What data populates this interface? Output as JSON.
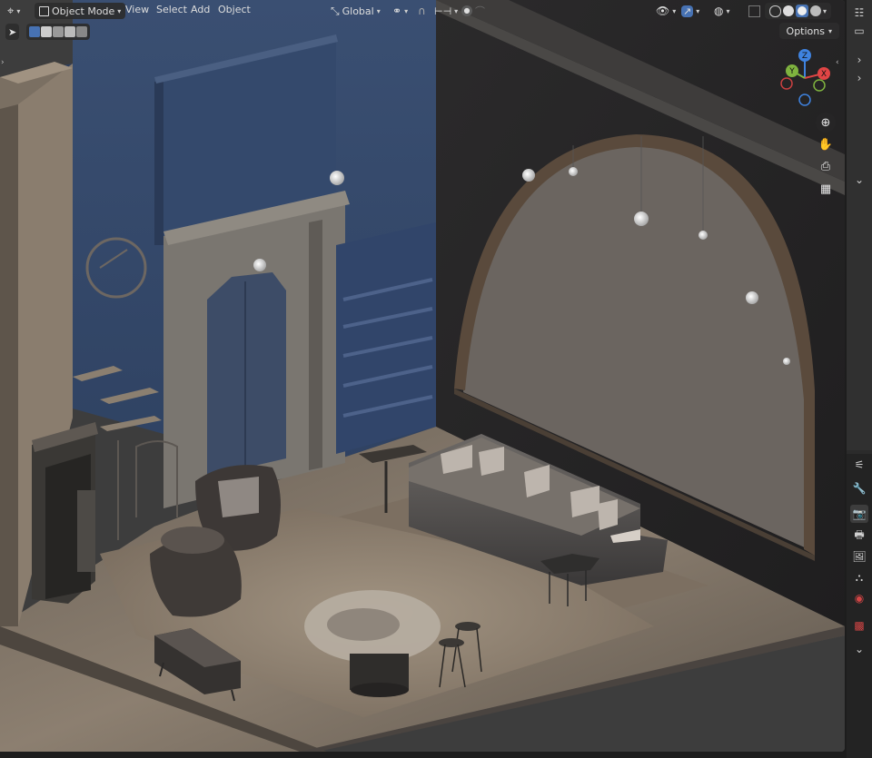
{
  "header": {
    "mode_label": "Object Mode",
    "menus": [
      "View",
      "Select",
      "Add",
      "Object"
    ],
    "transform_orientation": "Global",
    "options_label": "Options"
  },
  "gizmo": {
    "z_label": "Z",
    "y_label": "Y",
    "x_label": "X"
  },
  "icons": {
    "editor_type": "cursor-icon",
    "mode": "object-mode-icon",
    "orientation": "transform-orientation-icon",
    "pivot": "pivot-point-icon",
    "snap": "snap-icon",
    "proportional": "proportional-editing-icon",
    "visibility": "visibility-icon",
    "gizmos": "gizmo-icon",
    "overlays": "overlays-icon",
    "xray": "xray-icon",
    "shading": [
      "wireframe-shading-icon",
      "solid-shading-icon",
      "material-shading-icon",
      "rendered-shading-icon"
    ],
    "nav": [
      "zoom-icon",
      "pan-hand-icon",
      "camera-icon",
      "grid-ortho-icon"
    ],
    "properties": [
      "tool-icon",
      "render-icon",
      "output-icon",
      "view-layer-icon",
      "scene-icon",
      "world-icon",
      "texture-icon"
    ]
  },
  "colors": {
    "accent": "#4772b3",
    "axis_x": "#e04545",
    "axis_y": "#7fb33f",
    "axis_z": "#3f83e0"
  }
}
